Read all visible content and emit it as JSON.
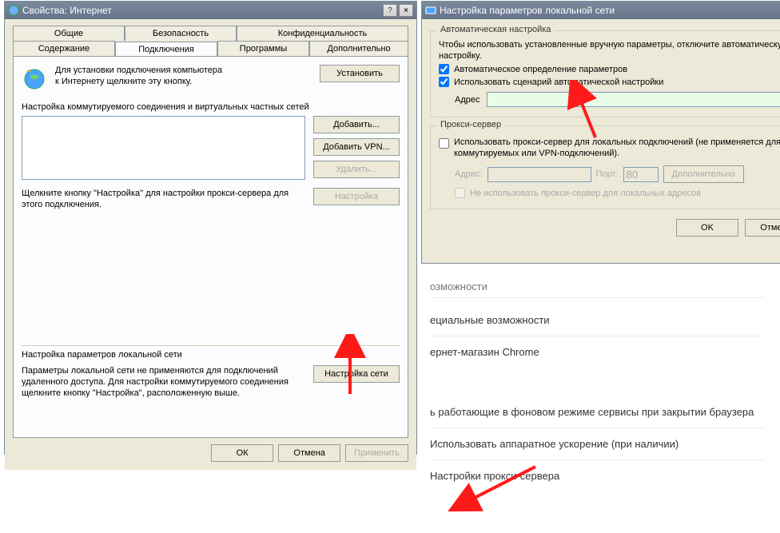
{
  "left_window": {
    "title": "Свойства: Интернет",
    "tabs_row1": [
      "Общие",
      "Безопасность",
      "Конфиденциальность"
    ],
    "tabs_row2": [
      "Содержание",
      "Подключения",
      "Программы",
      "Дополнительно"
    ],
    "active_tab": "Подключения",
    "setup_text": "Для установки подключения компьютера\nк Интернету щелкните эту кнопку.",
    "btn_setup": "Установить",
    "dialup_header": "Настройка коммутируемого соединения и виртуальных частных сетей",
    "btn_add": "Добавить...",
    "btn_add_vpn": "Добавить VPN...",
    "btn_remove": "Удалить...",
    "btn_settings": "Настройка",
    "proxy_hint": "Щелкните кнопку \"Настройка\" для настройки прокси-сервера для этого подключения.",
    "lan_header": "Настройка параметров локальной сети",
    "lan_text": "Параметры локальной сети не применяются для подключений удаленного доступа. Для настройки коммутируемого соединения щелкните кнопку \"Настройка\", расположенную выше.",
    "btn_lan": "Настройка сети",
    "btn_ok": "ОК",
    "btn_cancel": "Отмена",
    "btn_apply": "Применить"
  },
  "right_window": {
    "title": "Настройка параметров локальной сети",
    "grp_auto": "Автоматическая настройка",
    "auto_hint": "Чтобы использовать установленные вручную параметры, отключите автоматическую настройку.",
    "chk_autodetect": "Автоматическое определение параметров",
    "chk_script": "Использовать сценарий автоматической настройки",
    "lbl_address": "Адрес",
    "grp_proxy": "Прокси-сервер",
    "chk_proxy": "Использовать прокси-сервер для локальных подключений (не применяется для коммутируемых или VPN-подключений).",
    "lbl_addr2": "Адрес:",
    "lbl_port": "Порт:",
    "port_value": "80",
    "btn_advanced": "Дополнительно",
    "chk_bypass": "Не использовать прокси-сервер для локальных адресов",
    "btn_ok": "OK",
    "btn_cancel": "Отмена"
  },
  "chrome": {
    "head1": "озможности",
    "item1": "ециальные возможности",
    "item2": "ернет-магазин Chrome",
    "bg_line": "ь работающие в фоновом режиме сервисы при закрытии браузера",
    "hw_line": "Использовать аппаратное ускорение (при наличии)",
    "proxy_line": "Настройки прокси-сервера"
  }
}
